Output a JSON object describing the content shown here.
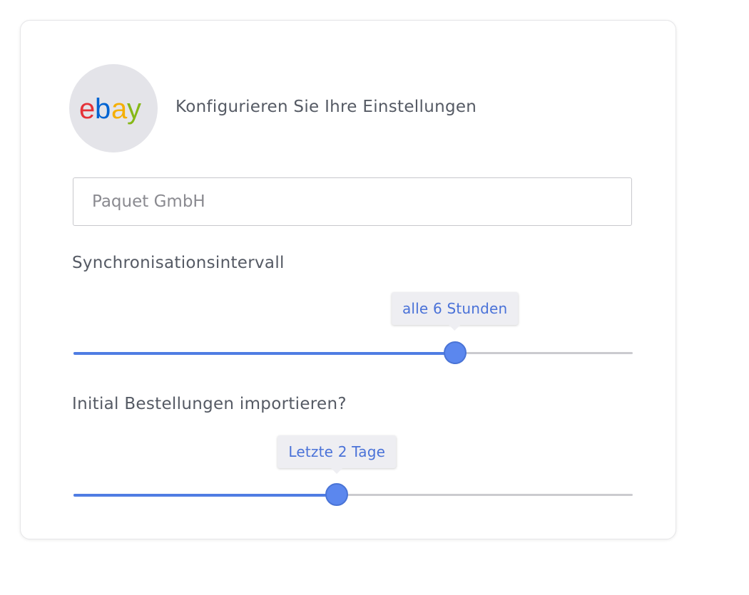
{
  "header": {
    "logo_letters": [
      "e",
      "b",
      "a",
      "y"
    ],
    "logo_colors": [
      "#e53238",
      "#0064d2",
      "#f5af02",
      "#86b817"
    ],
    "title": "Konfigurieren Sie Ihre Einstellungen"
  },
  "shop_name": {
    "value": "",
    "placeholder": "Paquet GmbH"
  },
  "sync_interval": {
    "label": "Synchronisationsintervall",
    "value_label": "alle 6 Stunden",
    "position_percent": 68.2
  },
  "initial_import": {
    "label": "Initial Bestellungen importieren?",
    "value_label": "Letzte 2 Tage",
    "position_percent": 47.1
  },
  "colors": {
    "accent": "#5b87ee",
    "track": "#cbcbcf",
    "tooltip_text": "#4a72d8"
  }
}
